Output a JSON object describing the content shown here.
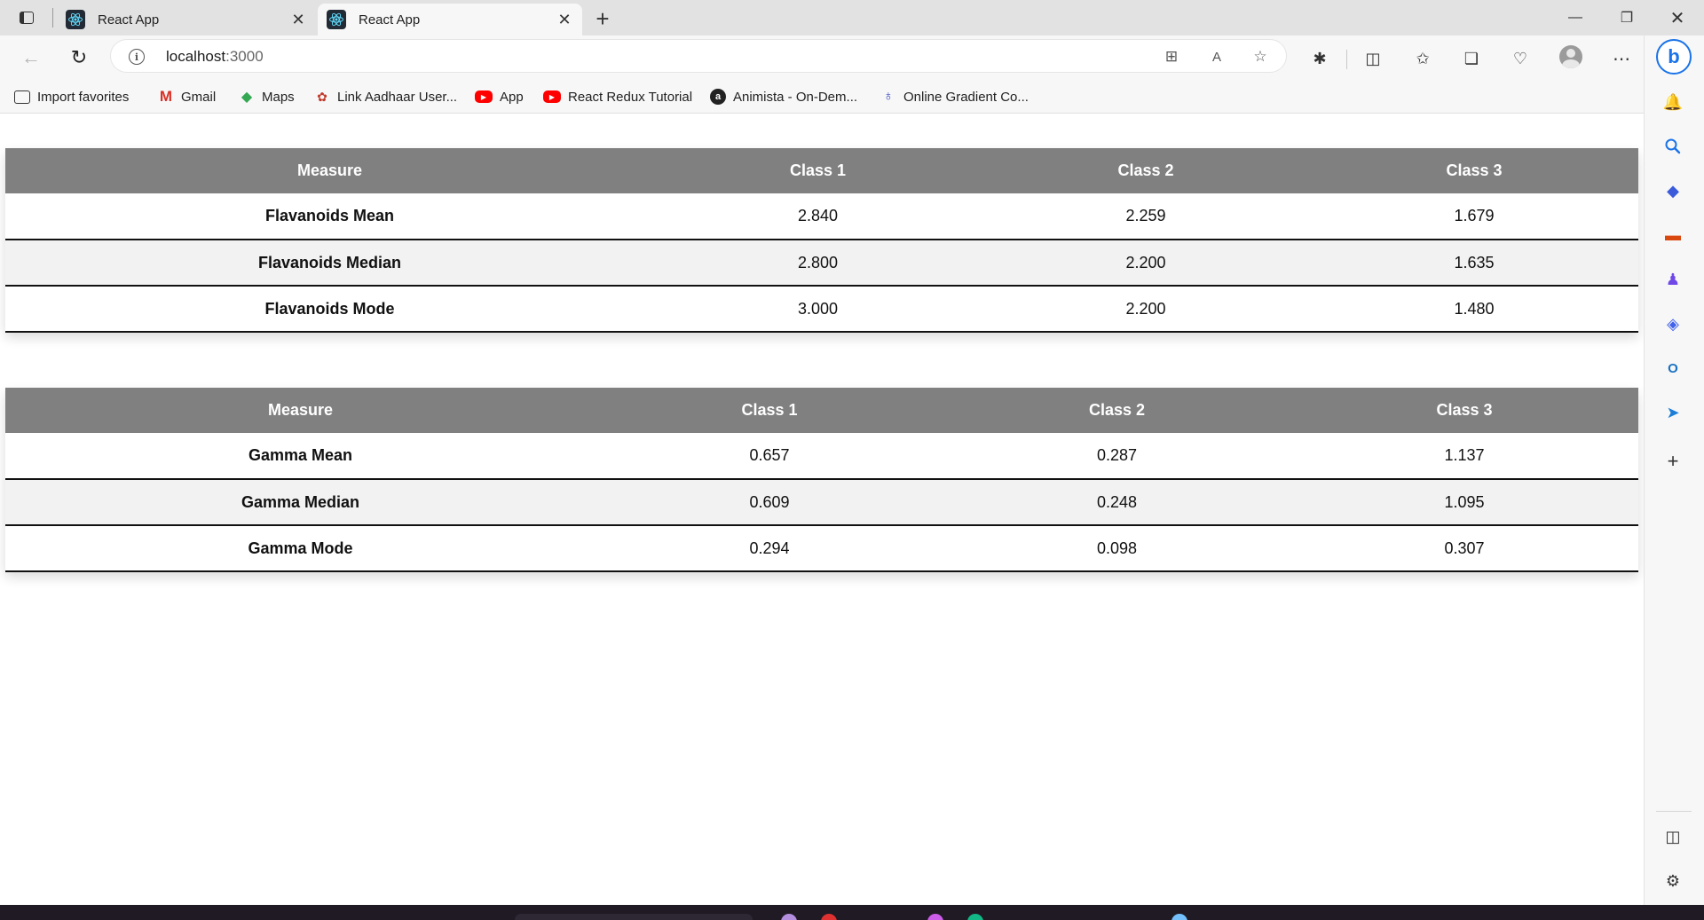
{
  "browser": {
    "tabs": [
      {
        "title": "React App",
        "active": false
      },
      {
        "title": "React App",
        "active": true
      }
    ],
    "address": {
      "host": "localhost",
      "port": ":3000"
    },
    "bookmarks": [
      {
        "label": "Import favorites",
        "icon": "import-icon"
      },
      {
        "label": "Gmail",
        "icon": "gmail-icon"
      },
      {
        "label": "Maps",
        "icon": "maps-icon"
      },
      {
        "label": "Link Aadhaar User...",
        "icon": "aadhaar-icon"
      },
      {
        "label": "App",
        "icon": "youtube-icon"
      },
      {
        "label": "React Redux Tutorial",
        "icon": "youtube-icon"
      },
      {
        "label": "Animista - On-Dem...",
        "icon": "animista-icon"
      },
      {
        "label": "Online Gradient Co...",
        "icon": "gradient-icon"
      }
    ]
  },
  "tables": {
    "flavanoids": {
      "headers": [
        "Measure",
        "Class 1",
        "Class 2",
        "Class 3"
      ],
      "rows": [
        {
          "measure": "Flavanoids Mean",
          "c1": "2.840",
          "c2": "2.259",
          "c3": "1.679"
        },
        {
          "measure": "Flavanoids Median",
          "c1": "2.800",
          "c2": "2.200",
          "c3": "1.635"
        },
        {
          "measure": "Flavanoids Mode",
          "c1": "3.000",
          "c2": "2.200",
          "c3": "1.480"
        }
      ]
    },
    "gamma": {
      "headers": [
        "Measure",
        "Class 1",
        "Class 2",
        "Class 3"
      ],
      "rows": [
        {
          "measure": "Gamma Mean",
          "c1": "0.657",
          "c2": "0.287",
          "c3": "1.137"
        },
        {
          "measure": "Gamma Median",
          "c1": "0.609",
          "c2": "0.248",
          "c3": "1.095"
        },
        {
          "measure": "Gamma Mode",
          "c1": "0.294",
          "c2": "0.098",
          "c3": "0.307"
        }
      ]
    }
  },
  "colors": {
    "header_bg": "#808080",
    "header_text": "#ffffff",
    "row_alt": "#f2f2f2",
    "row_border": "#111111"
  }
}
